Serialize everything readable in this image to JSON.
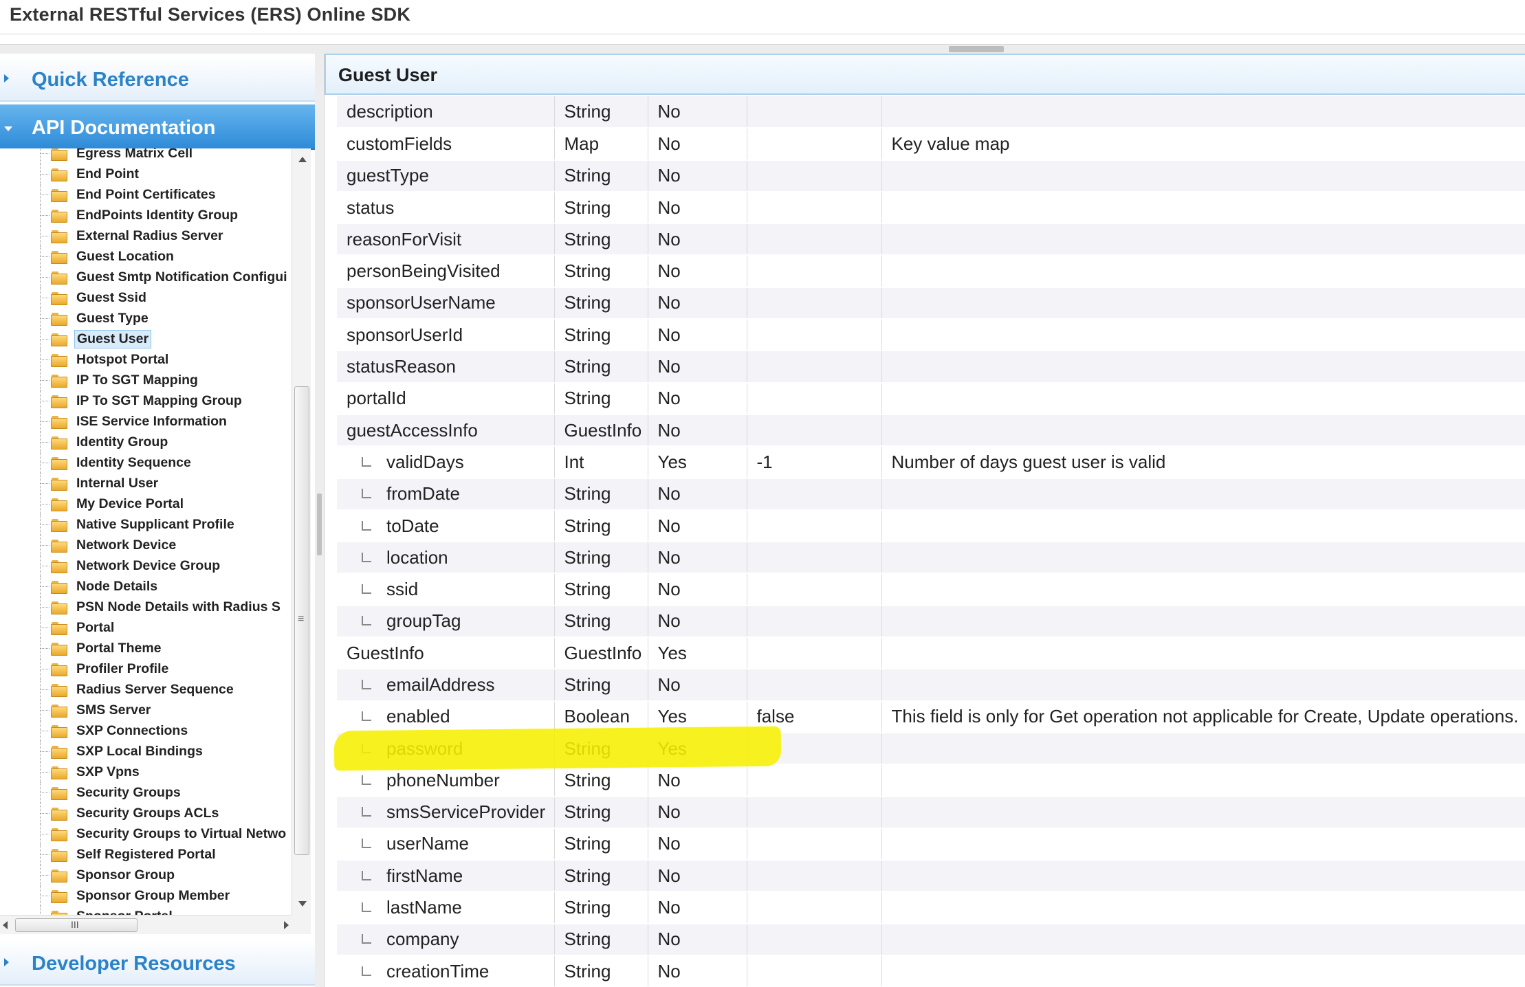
{
  "app": {
    "title": "External RESTful Services (ERS) Online SDK"
  },
  "sidebar": {
    "sections": {
      "quick_reference": "Quick Reference",
      "api_documentation": "API Documentation",
      "developer_resources": "Developer Resources"
    },
    "tree_items": [
      "Egress Matrix Cell",
      "End Point",
      "End Point Certificates",
      "EndPoints Identity Group",
      "External Radius Server",
      "Guest Location",
      "Guest Smtp Notification Configui",
      "Guest Ssid",
      "Guest Type",
      "Guest User",
      "Hotspot Portal",
      "IP To SGT Mapping",
      "IP To SGT Mapping Group",
      "ISE Service Information",
      "Identity Group",
      "Identity Sequence",
      "Internal User",
      "My Device Portal",
      "Native Supplicant Profile",
      "Network Device",
      "Network Device Group",
      "Node Details",
      "PSN Node Details with Radius S",
      "Portal",
      "Portal Theme",
      "Profiler Profile",
      "Radius Server Sequence",
      "SMS Server",
      "SXP Connections",
      "SXP Local Bindings",
      "SXP Vpns",
      "Security Groups",
      "Security Groups ACLs",
      "Security Groups to Virtual Netwo",
      "Self Registered Portal",
      "Sponsor Group",
      "Sponsor Group Member",
      "Sponsor Portal"
    ],
    "selected_item": "Guest User",
    "hscroll_grip": "III",
    "vscroll_grip": "≡"
  },
  "main": {
    "title": "Guest User",
    "rows": [
      {
        "name": "description",
        "child": false,
        "type": "String",
        "required": "No",
        "default": "",
        "desc": ""
      },
      {
        "name": "customFields",
        "child": false,
        "type": "Map",
        "required": "No",
        "default": "",
        "desc": "Key value map"
      },
      {
        "name": "guestType",
        "child": false,
        "type": "String",
        "required": "No",
        "default": "",
        "desc": ""
      },
      {
        "name": "status",
        "child": false,
        "type": "String",
        "required": "No",
        "default": "",
        "desc": ""
      },
      {
        "name": "reasonForVisit",
        "child": false,
        "type": "String",
        "required": "No",
        "default": "",
        "desc": ""
      },
      {
        "name": "personBeingVisited",
        "child": false,
        "type": "String",
        "required": "No",
        "default": "",
        "desc": ""
      },
      {
        "name": "sponsorUserName",
        "child": false,
        "type": "String",
        "required": "No",
        "default": "",
        "desc": ""
      },
      {
        "name": "sponsorUserId",
        "child": false,
        "type": "String",
        "required": "No",
        "default": "",
        "desc": ""
      },
      {
        "name": "statusReason",
        "child": false,
        "type": "String",
        "required": "No",
        "default": "",
        "desc": ""
      },
      {
        "name": "portalId",
        "child": false,
        "type": "String",
        "required": "No",
        "default": "",
        "desc": ""
      },
      {
        "name": "guestAccessInfo",
        "child": false,
        "type": "GuestInfo",
        "required": "No",
        "default": "",
        "desc": ""
      },
      {
        "name": "validDays",
        "child": true,
        "type": "Int",
        "required": "Yes",
        "default": "-1",
        "desc": "Number of days guest user is valid"
      },
      {
        "name": "fromDate",
        "child": true,
        "type": "String",
        "required": "No",
        "default": "",
        "desc": ""
      },
      {
        "name": "toDate",
        "child": true,
        "type": "String",
        "required": "No",
        "default": "",
        "desc": ""
      },
      {
        "name": "location",
        "child": true,
        "type": "String",
        "required": "No",
        "default": "",
        "desc": ""
      },
      {
        "name": "ssid",
        "child": true,
        "type": "String",
        "required": "No",
        "default": "",
        "desc": ""
      },
      {
        "name": "groupTag",
        "child": true,
        "type": "String",
        "required": "No",
        "default": "",
        "desc": ""
      },
      {
        "name": "GuestInfo",
        "child": false,
        "type": "GuestInfo",
        "required": "Yes",
        "default": "",
        "desc": ""
      },
      {
        "name": "emailAddress",
        "child": true,
        "type": "String",
        "required": "No",
        "default": "",
        "desc": ""
      },
      {
        "name": "enabled",
        "child": true,
        "type": "Boolean",
        "required": "Yes",
        "default": "false",
        "desc": "This field is only for Get operation not applicable for Create, Update operations."
      },
      {
        "name": "password",
        "child": true,
        "type": "String",
        "required": "Yes",
        "default": "",
        "desc": ""
      },
      {
        "name": "phoneNumber",
        "child": true,
        "type": "String",
        "required": "No",
        "default": "",
        "desc": ""
      },
      {
        "name": "smsServiceProvider",
        "child": true,
        "type": "String",
        "required": "No",
        "default": "",
        "desc": ""
      },
      {
        "name": "userName",
        "child": true,
        "type": "String",
        "required": "No",
        "default": "",
        "desc": ""
      },
      {
        "name": "firstName",
        "child": true,
        "type": "String",
        "required": "No",
        "default": "",
        "desc": ""
      },
      {
        "name": "lastName",
        "child": true,
        "type": "String",
        "required": "No",
        "default": "",
        "desc": ""
      },
      {
        "name": "company",
        "child": true,
        "type": "String",
        "required": "No",
        "default": "",
        "desc": ""
      },
      {
        "name": "creationTime",
        "child": true,
        "type": "String",
        "required": "No",
        "default": "",
        "desc": ""
      }
    ],
    "highlight_color": "#f6f000"
  },
  "colors": {
    "accent": "#2a82c8",
    "active_header": "#2e8bd8"
  }
}
